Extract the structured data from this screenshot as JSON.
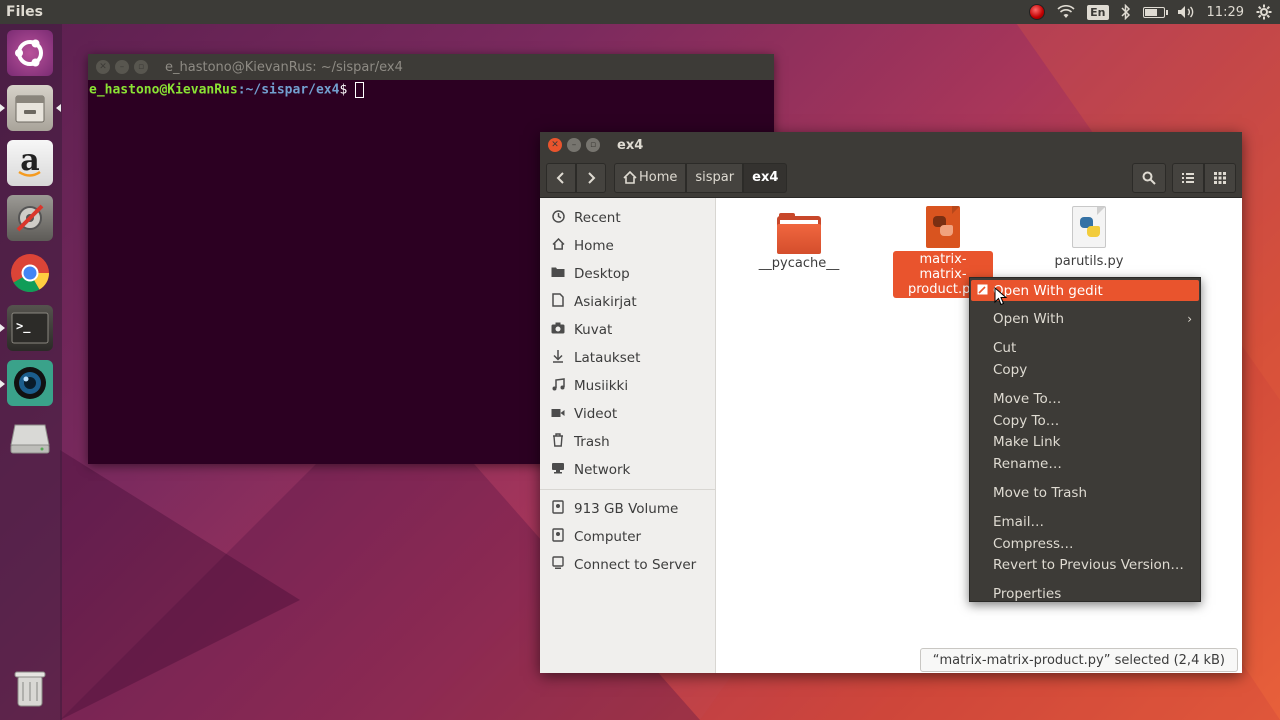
{
  "top_panel": {
    "app_title": "Files",
    "lang": "En",
    "time": "11:29"
  },
  "launcher": {
    "items": [
      "ubuntu-dash",
      "files",
      "amazon",
      "system-settings",
      "chrome",
      "terminal",
      "camera",
      "disk",
      "trash"
    ]
  },
  "terminal": {
    "title": "e_hastono@KievanRus: ~/sispar/ex4",
    "prompt_user": "e_hastono@KievanRus",
    "prompt_path": ":~/sispar/ex4",
    "prompt_symbol": "$ "
  },
  "files": {
    "title": "ex4",
    "breadcrumbs": [
      "Home",
      "sispar",
      "ex4"
    ],
    "sidebar": {
      "places": [
        "Recent",
        "Home",
        "Desktop",
        "Asiakirjat",
        "Kuvat",
        "Lataukset",
        "Musiikki",
        "Videot",
        "Trash",
        "Network"
      ],
      "devices": [
        "913 GB Volume",
        "Computer",
        "Connect to Server"
      ]
    },
    "items": [
      {
        "name": "__pycache__"
      },
      {
        "name": "matrix-matrix-product.py",
        "line1": "matrix-matrix-",
        "line2": "product.py"
      },
      {
        "name": "parutils.py"
      }
    ],
    "status": "“matrix-matrix-product.py” selected  (2,4 kB)"
  },
  "context_menu": {
    "open_with_gedit": "Open With gedit",
    "open_with": "Open With",
    "cut": "Cut",
    "copy": "Copy",
    "move_to": "Move To…",
    "copy_to": "Copy To…",
    "make_link": "Make Link",
    "rename": "Rename…",
    "move_to_trash": "Move to Trash",
    "email": "Email…",
    "compress": "Compress…",
    "revert": "Revert to Previous Version…",
    "properties": "Properties"
  },
  "colors": {
    "accent": "#e9542d",
    "panel": "#3c3b37",
    "terminal_bg": "#2c0022"
  }
}
